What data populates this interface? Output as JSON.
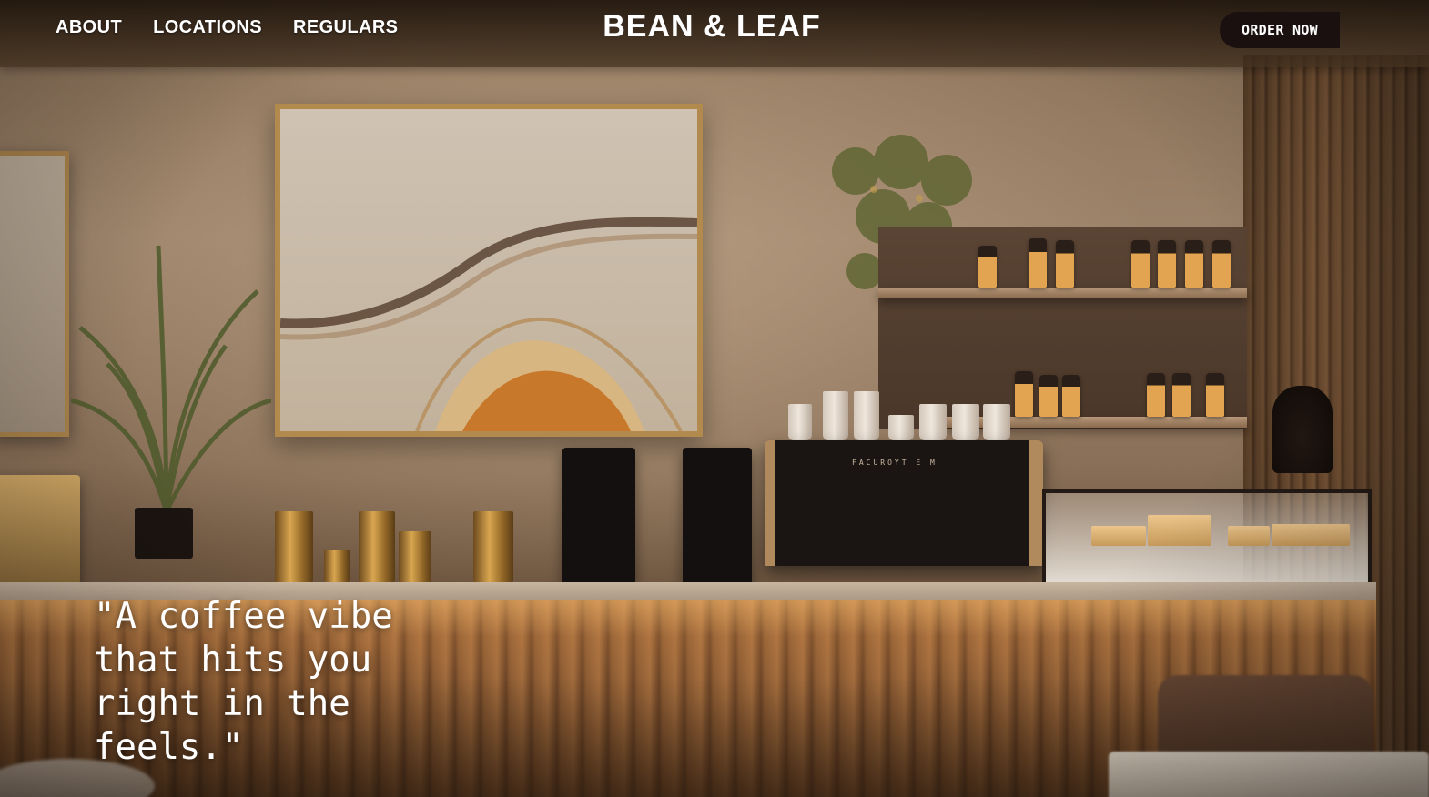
{
  "nav": {
    "links": [
      {
        "label": "ABOUT"
      },
      {
        "label": "LOCATIONS"
      },
      {
        "label": "REGULARS"
      }
    ],
    "brand": "BEAN & LEAF",
    "order_button": "ORDER NOW"
  },
  "hero": {
    "quote": "\"A coffee vibe that hits you right in the feels.\""
  },
  "colors": {
    "nav_text": "#ffffff",
    "order_button_bg": "#1a1010",
    "quote_text": "#ffffff"
  }
}
